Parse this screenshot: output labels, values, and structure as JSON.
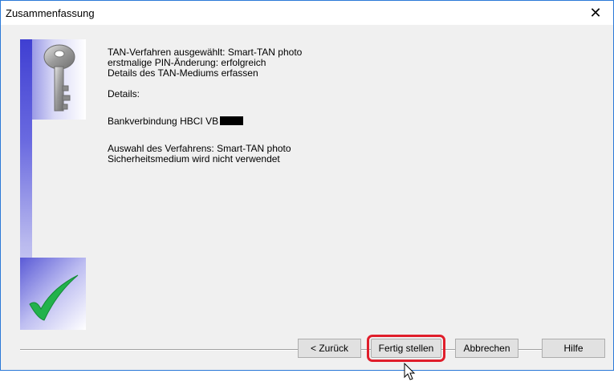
{
  "window": {
    "title": "Zusammenfassung",
    "close_label": "✕"
  },
  "summary": {
    "lines_top": [
      "TAN-Verfahren ausgewählt: Smart-TAN photo",
      "erstmalige PIN-Änderung: erfolgreich",
      "Details des TAN-Mediums erfassen"
    ],
    "details_label": "Details:",
    "bank_connection": "Bankverbindung HBCI VB",
    "lines_bottom": [
      "Auswahl des Verfahrens: Smart-TAN photo",
      "Sicherheitsmedium wird nicht verwendet"
    ]
  },
  "buttons": {
    "back": "< Zurück",
    "finish": "Fertig stellen",
    "cancel": "Abbrechen",
    "help": "Hilfe"
  },
  "icons": {
    "key": "key-icon",
    "check": "checkmark-icon",
    "close": "close-icon",
    "cursor": "mouse-pointer-icon"
  },
  "colors": {
    "highlight": "#e01e2b",
    "checkmark": "#22b24c",
    "sidebar": "#3f3fd2"
  }
}
